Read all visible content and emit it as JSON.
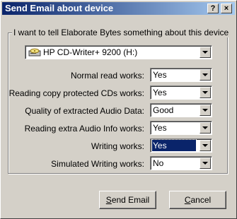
{
  "window": {
    "title": "Send Email about device",
    "help_label": "?",
    "close_label": "×"
  },
  "group": {
    "legend": "I want to tell Elaborate Bytes something about this device"
  },
  "device": {
    "selected": "HP CD-Writer+ 9200 (H:)",
    "icon": "cd-drive-icon"
  },
  "rows": [
    {
      "label": "Normal read works:",
      "value": "Yes"
    },
    {
      "label": "Reading copy protected CDs works:",
      "value": "Yes"
    },
    {
      "label": "Quality of extracted Audio Data:",
      "value": "Good"
    },
    {
      "label": "Reading extra Audio Info works:",
      "value": "Yes"
    },
    {
      "label": "Writing works:",
      "value": "Yes"
    },
    {
      "label": "Simulated Writing works:",
      "value": "No"
    }
  ],
  "buttons": {
    "send_accel": "S",
    "send_rest": "end Email",
    "cancel_accel": "C",
    "cancel_rest": "ancel"
  },
  "colors": {
    "titlebar_start": "#0a246a",
    "titlebar_end": "#a6caf0",
    "face": "#d4d0c8",
    "selection": "#0a246a"
  }
}
